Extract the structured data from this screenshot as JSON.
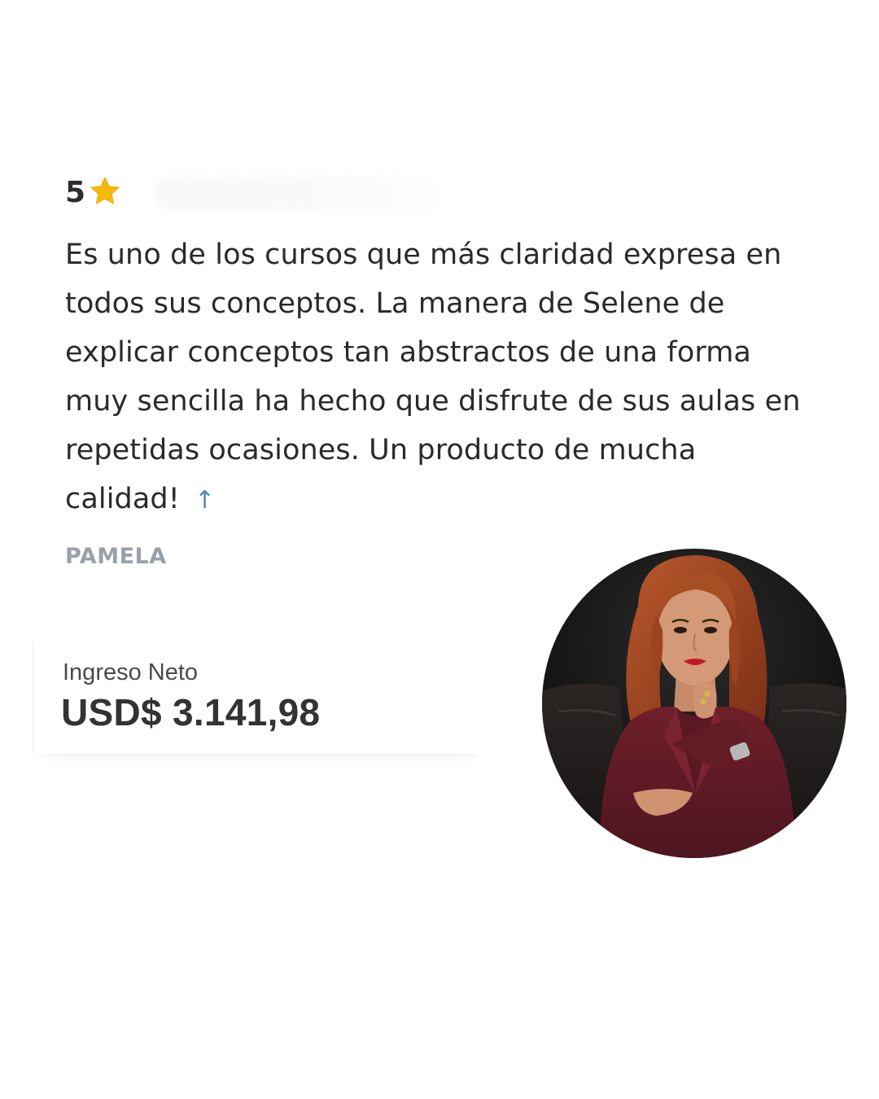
{
  "review": {
    "rating": "5",
    "star_icon": "star-icon",
    "text": "Es uno de los cursos que más claridad expresa en todos sus conceptos. La manera de Selene de explicar conceptos tan abstractos de una forma muy sencilla ha hecho que disfrute de sus aulas en repetidas ocasiones. Un producto de mucha calidad!",
    "expand_icon": "arrow-up-icon",
    "expand_symbol": "↑",
    "author": "PAMELA"
  },
  "income": {
    "label": "Ingreso Neto",
    "value": "USD$ 3.141,98"
  },
  "colors": {
    "star": "#F5B90A",
    "accent": "#4F86C9",
    "author": "#9AA0AA"
  }
}
